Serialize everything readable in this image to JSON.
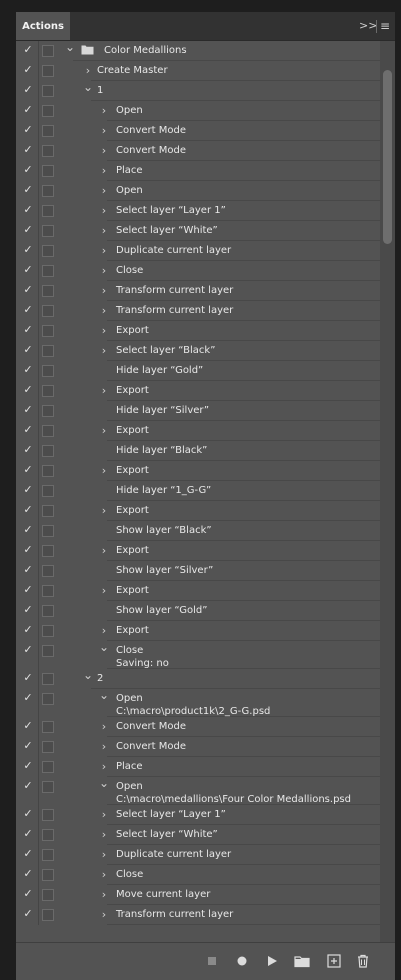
{
  "panel": {
    "tab_label": "Actions",
    "collapse_icon": "double-chevron-right-icon",
    "menu_icon": "hamburger-menu-icon"
  },
  "rows": [
    {
      "check": "✓",
      "dialog": false,
      "indent": 0,
      "chevron": "down",
      "folder": true,
      "label": "Color Medallions",
      "sub": ""
    },
    {
      "check": "✓",
      "dialog": false,
      "indent": 1,
      "chevron": "right",
      "folder": false,
      "label": "Create Master",
      "sub": ""
    },
    {
      "check": "✓",
      "dialog": false,
      "indent": 1,
      "chevron": "down",
      "folder": false,
      "label": "1",
      "sub": ""
    },
    {
      "check": "✓",
      "dialog": false,
      "indent": 2,
      "chevron": "right",
      "folder": false,
      "label": "Open",
      "sub": ""
    },
    {
      "check": "✓",
      "dialog": false,
      "indent": 2,
      "chevron": "right",
      "folder": false,
      "label": "Convert Mode",
      "sub": ""
    },
    {
      "check": "✓",
      "dialog": false,
      "indent": 2,
      "chevron": "right",
      "folder": false,
      "label": "Convert Mode",
      "sub": ""
    },
    {
      "check": "✓",
      "dialog": false,
      "indent": 2,
      "chevron": "right",
      "folder": false,
      "label": "Place",
      "sub": ""
    },
    {
      "check": "✓",
      "dialog": false,
      "indent": 2,
      "chevron": "right",
      "folder": false,
      "label": "Open",
      "sub": ""
    },
    {
      "check": "✓",
      "dialog": false,
      "indent": 2,
      "chevron": "right",
      "folder": false,
      "label": "Select layer “Layer 1”",
      "sub": ""
    },
    {
      "check": "✓",
      "dialog": false,
      "indent": 2,
      "chevron": "right",
      "folder": false,
      "label": "Select layer “White”",
      "sub": ""
    },
    {
      "check": "✓",
      "dialog": false,
      "indent": 2,
      "chevron": "right",
      "folder": false,
      "label": "Duplicate current layer",
      "sub": ""
    },
    {
      "check": "✓",
      "dialog": false,
      "indent": 2,
      "chevron": "right",
      "folder": false,
      "label": "Close",
      "sub": ""
    },
    {
      "check": "✓",
      "dialog": false,
      "indent": 2,
      "chevron": "right",
      "folder": false,
      "label": "Transform current layer",
      "sub": ""
    },
    {
      "check": "✓",
      "dialog": false,
      "indent": 2,
      "chevron": "right",
      "folder": false,
      "label": "Transform current layer",
      "sub": ""
    },
    {
      "check": "✓",
      "dialog": false,
      "indent": 2,
      "chevron": "right",
      "folder": false,
      "label": "Export",
      "sub": ""
    },
    {
      "check": "✓",
      "dialog": false,
      "indent": 2,
      "chevron": "right",
      "folder": false,
      "label": "Select layer “Black”",
      "sub": ""
    },
    {
      "check": "✓",
      "dialog": false,
      "indent": 2,
      "chevron": "none",
      "folder": false,
      "label": "Hide layer “Gold”",
      "sub": ""
    },
    {
      "check": "✓",
      "dialog": false,
      "indent": 2,
      "chevron": "right",
      "folder": false,
      "label": "Export",
      "sub": ""
    },
    {
      "check": "✓",
      "dialog": false,
      "indent": 2,
      "chevron": "none",
      "folder": false,
      "label": "Hide layer “Silver”",
      "sub": ""
    },
    {
      "check": "✓",
      "dialog": false,
      "indent": 2,
      "chevron": "right",
      "folder": false,
      "label": "Export",
      "sub": ""
    },
    {
      "check": "✓",
      "dialog": false,
      "indent": 2,
      "chevron": "none",
      "folder": false,
      "label": "Hide layer “Black”",
      "sub": ""
    },
    {
      "check": "✓",
      "dialog": false,
      "indent": 2,
      "chevron": "right",
      "folder": false,
      "label": "Export",
      "sub": ""
    },
    {
      "check": "✓",
      "dialog": false,
      "indent": 2,
      "chevron": "none",
      "folder": false,
      "label": "Hide layer “1_G-G”",
      "sub": ""
    },
    {
      "check": "✓",
      "dialog": false,
      "indent": 2,
      "chevron": "right",
      "folder": false,
      "label": "Export",
      "sub": ""
    },
    {
      "check": "✓",
      "dialog": false,
      "indent": 2,
      "chevron": "none",
      "folder": false,
      "label": "Show layer “Black”",
      "sub": ""
    },
    {
      "check": "✓",
      "dialog": false,
      "indent": 2,
      "chevron": "right",
      "folder": false,
      "label": "Export",
      "sub": ""
    },
    {
      "check": "✓",
      "dialog": false,
      "indent": 2,
      "chevron": "none",
      "folder": false,
      "label": "Show layer “Silver”",
      "sub": ""
    },
    {
      "check": "✓",
      "dialog": false,
      "indent": 2,
      "chevron": "right",
      "folder": false,
      "label": "Export",
      "sub": ""
    },
    {
      "check": "✓",
      "dialog": false,
      "indent": 2,
      "chevron": "none",
      "folder": false,
      "label": "Show layer “Gold”",
      "sub": ""
    },
    {
      "check": "✓",
      "dialog": false,
      "indent": 2,
      "chevron": "right",
      "folder": false,
      "label": "Export",
      "sub": ""
    },
    {
      "check": "✓",
      "dialog": false,
      "indent": 2,
      "chevron": "down",
      "folder": false,
      "label": "Close",
      "sub": "Saving: no",
      "tall": true
    },
    {
      "check": "✓",
      "dialog": false,
      "indent": 1,
      "chevron": "down",
      "folder": false,
      "label": "2",
      "sub": ""
    },
    {
      "check": "✓",
      "dialog": false,
      "indent": 2,
      "chevron": "down",
      "folder": false,
      "label": "Open",
      "sub": "C:\\macro\\product1k\\2_G-G.psd",
      "tall": true
    },
    {
      "check": "✓",
      "dialog": false,
      "indent": 2,
      "chevron": "right",
      "folder": false,
      "label": "Convert Mode",
      "sub": ""
    },
    {
      "check": "✓",
      "dialog": false,
      "indent": 2,
      "chevron": "right",
      "folder": false,
      "label": "Convert Mode",
      "sub": ""
    },
    {
      "check": "✓",
      "dialog": false,
      "indent": 2,
      "chevron": "right",
      "folder": false,
      "label": "Place",
      "sub": ""
    },
    {
      "check": "✓",
      "dialog": false,
      "indent": 2,
      "chevron": "down",
      "folder": false,
      "label": "Open",
      "sub": "C:\\macro\\medallions\\Four Color Medallions.psd",
      "tall": true
    },
    {
      "check": "✓",
      "dialog": false,
      "indent": 2,
      "chevron": "right",
      "folder": false,
      "label": "Select layer “Layer 1”",
      "sub": ""
    },
    {
      "check": "✓",
      "dialog": false,
      "indent": 2,
      "chevron": "right",
      "folder": false,
      "label": "Select layer “White”",
      "sub": ""
    },
    {
      "check": "✓",
      "dialog": false,
      "indent": 2,
      "chevron": "right",
      "folder": false,
      "label": "Duplicate current layer",
      "sub": ""
    },
    {
      "check": "✓",
      "dialog": false,
      "indent": 2,
      "chevron": "right",
      "folder": false,
      "label": "Close",
      "sub": ""
    },
    {
      "check": "✓",
      "dialog": false,
      "indent": 2,
      "chevron": "right",
      "folder": false,
      "label": "Move current layer",
      "sub": ""
    },
    {
      "check": "✓",
      "dialog": false,
      "indent": 2,
      "chevron": "right",
      "folder": false,
      "label": "Transform current layer",
      "sub": ""
    }
  ],
  "toolbar": {
    "stop_icon": "stop-recording-icon",
    "record_icon": "record-icon",
    "play_icon": "play-selection-icon",
    "new_set_icon": "new-set-folder-icon",
    "new_action_icon": "new-action-icon",
    "delete_icon": "trash-icon"
  },
  "colors": {
    "panel_bg": "#535353",
    "tabbar_bg": "#323232",
    "app_bg": "#1e1e1e",
    "text": "#e8e8e8"
  }
}
